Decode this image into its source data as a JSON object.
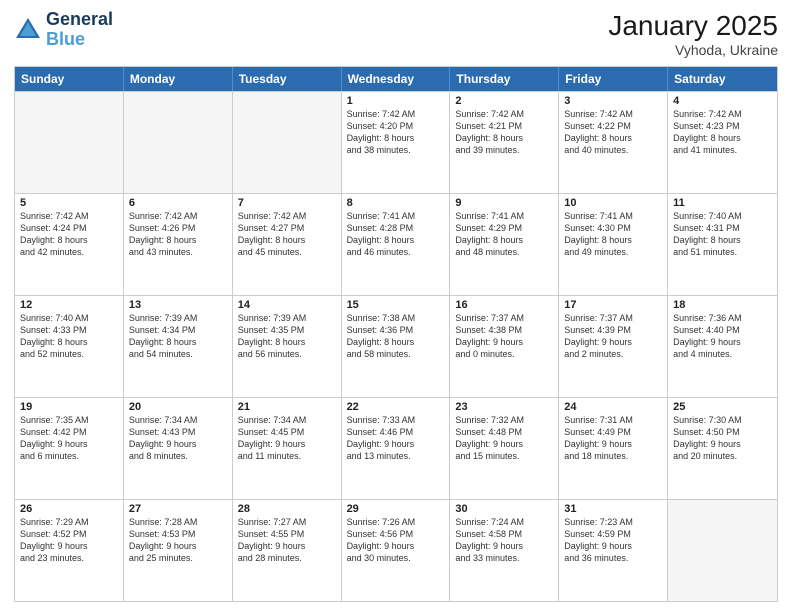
{
  "header": {
    "logo_line1": "General",
    "logo_line2": "Blue",
    "main_title": "January 2025",
    "subtitle": "Vyhoda, Ukraine"
  },
  "days_of_week": [
    "Sunday",
    "Monday",
    "Tuesday",
    "Wednesday",
    "Thursday",
    "Friday",
    "Saturday"
  ],
  "weeks": [
    [
      {
        "day": "",
        "lines": []
      },
      {
        "day": "",
        "lines": []
      },
      {
        "day": "",
        "lines": []
      },
      {
        "day": "1",
        "lines": [
          "Sunrise: 7:42 AM",
          "Sunset: 4:20 PM",
          "Daylight: 8 hours",
          "and 38 minutes."
        ]
      },
      {
        "day": "2",
        "lines": [
          "Sunrise: 7:42 AM",
          "Sunset: 4:21 PM",
          "Daylight: 8 hours",
          "and 39 minutes."
        ]
      },
      {
        "day": "3",
        "lines": [
          "Sunrise: 7:42 AM",
          "Sunset: 4:22 PM",
          "Daylight: 8 hours",
          "and 40 minutes."
        ]
      },
      {
        "day": "4",
        "lines": [
          "Sunrise: 7:42 AM",
          "Sunset: 4:23 PM",
          "Daylight: 8 hours",
          "and 41 minutes."
        ]
      }
    ],
    [
      {
        "day": "5",
        "lines": [
          "Sunrise: 7:42 AM",
          "Sunset: 4:24 PM",
          "Daylight: 8 hours",
          "and 42 minutes."
        ]
      },
      {
        "day": "6",
        "lines": [
          "Sunrise: 7:42 AM",
          "Sunset: 4:26 PM",
          "Daylight: 8 hours",
          "and 43 minutes."
        ]
      },
      {
        "day": "7",
        "lines": [
          "Sunrise: 7:42 AM",
          "Sunset: 4:27 PM",
          "Daylight: 8 hours",
          "and 45 minutes."
        ]
      },
      {
        "day": "8",
        "lines": [
          "Sunrise: 7:41 AM",
          "Sunset: 4:28 PM",
          "Daylight: 8 hours",
          "and 46 minutes."
        ]
      },
      {
        "day": "9",
        "lines": [
          "Sunrise: 7:41 AM",
          "Sunset: 4:29 PM",
          "Daylight: 8 hours",
          "and 48 minutes."
        ]
      },
      {
        "day": "10",
        "lines": [
          "Sunrise: 7:41 AM",
          "Sunset: 4:30 PM",
          "Daylight: 8 hours",
          "and 49 minutes."
        ]
      },
      {
        "day": "11",
        "lines": [
          "Sunrise: 7:40 AM",
          "Sunset: 4:31 PM",
          "Daylight: 8 hours",
          "and 51 minutes."
        ]
      }
    ],
    [
      {
        "day": "12",
        "lines": [
          "Sunrise: 7:40 AM",
          "Sunset: 4:33 PM",
          "Daylight: 8 hours",
          "and 52 minutes."
        ]
      },
      {
        "day": "13",
        "lines": [
          "Sunrise: 7:39 AM",
          "Sunset: 4:34 PM",
          "Daylight: 8 hours",
          "and 54 minutes."
        ]
      },
      {
        "day": "14",
        "lines": [
          "Sunrise: 7:39 AM",
          "Sunset: 4:35 PM",
          "Daylight: 8 hours",
          "and 56 minutes."
        ]
      },
      {
        "day": "15",
        "lines": [
          "Sunrise: 7:38 AM",
          "Sunset: 4:36 PM",
          "Daylight: 8 hours",
          "and 58 minutes."
        ]
      },
      {
        "day": "16",
        "lines": [
          "Sunrise: 7:37 AM",
          "Sunset: 4:38 PM",
          "Daylight: 9 hours",
          "and 0 minutes."
        ]
      },
      {
        "day": "17",
        "lines": [
          "Sunrise: 7:37 AM",
          "Sunset: 4:39 PM",
          "Daylight: 9 hours",
          "and 2 minutes."
        ]
      },
      {
        "day": "18",
        "lines": [
          "Sunrise: 7:36 AM",
          "Sunset: 4:40 PM",
          "Daylight: 9 hours",
          "and 4 minutes."
        ]
      }
    ],
    [
      {
        "day": "19",
        "lines": [
          "Sunrise: 7:35 AM",
          "Sunset: 4:42 PM",
          "Daylight: 9 hours",
          "and 6 minutes."
        ]
      },
      {
        "day": "20",
        "lines": [
          "Sunrise: 7:34 AM",
          "Sunset: 4:43 PM",
          "Daylight: 9 hours",
          "and 8 minutes."
        ]
      },
      {
        "day": "21",
        "lines": [
          "Sunrise: 7:34 AM",
          "Sunset: 4:45 PM",
          "Daylight: 9 hours",
          "and 11 minutes."
        ]
      },
      {
        "day": "22",
        "lines": [
          "Sunrise: 7:33 AM",
          "Sunset: 4:46 PM",
          "Daylight: 9 hours",
          "and 13 minutes."
        ]
      },
      {
        "day": "23",
        "lines": [
          "Sunrise: 7:32 AM",
          "Sunset: 4:48 PM",
          "Daylight: 9 hours",
          "and 15 minutes."
        ]
      },
      {
        "day": "24",
        "lines": [
          "Sunrise: 7:31 AM",
          "Sunset: 4:49 PM",
          "Daylight: 9 hours",
          "and 18 minutes."
        ]
      },
      {
        "day": "25",
        "lines": [
          "Sunrise: 7:30 AM",
          "Sunset: 4:50 PM",
          "Daylight: 9 hours",
          "and 20 minutes."
        ]
      }
    ],
    [
      {
        "day": "26",
        "lines": [
          "Sunrise: 7:29 AM",
          "Sunset: 4:52 PM",
          "Daylight: 9 hours",
          "and 23 minutes."
        ]
      },
      {
        "day": "27",
        "lines": [
          "Sunrise: 7:28 AM",
          "Sunset: 4:53 PM",
          "Daylight: 9 hours",
          "and 25 minutes."
        ]
      },
      {
        "day": "28",
        "lines": [
          "Sunrise: 7:27 AM",
          "Sunset: 4:55 PM",
          "Daylight: 9 hours",
          "and 28 minutes."
        ]
      },
      {
        "day": "29",
        "lines": [
          "Sunrise: 7:26 AM",
          "Sunset: 4:56 PM",
          "Daylight: 9 hours",
          "and 30 minutes."
        ]
      },
      {
        "day": "30",
        "lines": [
          "Sunrise: 7:24 AM",
          "Sunset: 4:58 PM",
          "Daylight: 9 hours",
          "and 33 minutes."
        ]
      },
      {
        "day": "31",
        "lines": [
          "Sunrise: 7:23 AM",
          "Sunset: 4:59 PM",
          "Daylight: 9 hours",
          "and 36 minutes."
        ]
      },
      {
        "day": "",
        "lines": []
      }
    ]
  ]
}
